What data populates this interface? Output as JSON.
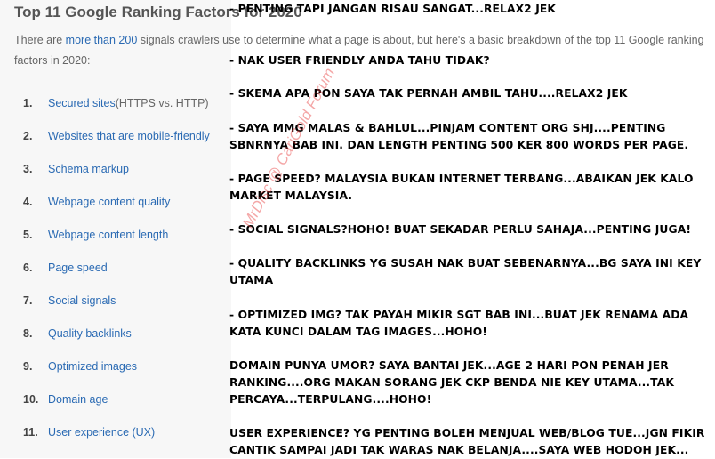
{
  "title": "Top 11 Google Ranking Factors for 2020",
  "intro": {
    "pre": "There are ",
    "link": "more than 200",
    "post": " signals crawlers use to determine what a page is about, but here's a basic breakdown of the top 11 Google ranking",
    "line2": "factors in 2020:"
  },
  "factors": [
    {
      "num": "1.",
      "label": "Secured sites",
      "suffix": " (HTTPS vs. HTTP)"
    },
    {
      "num": "2.",
      "label": "Websites that are mobile-friendly",
      "suffix": ""
    },
    {
      "num": "3.",
      "label": "Schema markup",
      "suffix": ""
    },
    {
      "num": "4.",
      "label": "Webpage content quality",
      "suffix": ""
    },
    {
      "num": "5.",
      "label": "Webpage content length",
      "suffix": ""
    },
    {
      "num": "6.",
      "label": "Page speed",
      "suffix": ""
    },
    {
      "num": "7.",
      "label": "Social signals",
      "suffix": ""
    },
    {
      "num": "8.",
      "label": "Quality backlinks",
      "suffix": ""
    },
    {
      "num": "9.",
      "label": "Optimized images",
      "suffix": ""
    },
    {
      "num": "10.",
      "label": "Domain age",
      "suffix": ""
    },
    {
      "num": "11.",
      "label": "User experience (UX)",
      "suffix": ""
    }
  ],
  "comments": [
    "-  PENTING TAPI JANGAN RISAU SANGAT...RELAX2 JEK",
    "-  NAK USER FRIENDLY ANDA TAHU TIDAK?",
    "- SKEMA APA PON SAYA TAK PERNAH AMBIL TAHU....RELAX2 JEK",
    "- SAYA MMG MALAS & BAHLUL...PINJAM CONTENT ORG SHJ....PENTING",
    "SBNRNYA BAB INI. DAN LENGTH PENTING 500 KER 800 WORDS PER PAGE.",
    "- PAGE SPEED? MALAYSIA BUKAN INTERNET TERBANG...ABAIKAN JEK KALO",
    "MARKET MALAYSIA.",
    "- SOCIAL SIGNALS?HOHO! BUAT SEKADAR PERLU SAHAJA...PENTING JUGA!",
    "- QUALITY BACKLINKS YG SUSAH NAK BUAT SEBENARNYA...BG SAYA INI KEY",
    "UTAMA",
    "- OPTIMIZED IMG? TAK PAYAH MIKIR SGT BAB INI...BUAT JEK RENAMA ADA",
    "KATA KUNCI DALAM TAG IMAGES...HOHO!",
    "DOMAIN PUNYA UMOR? SAYA BANTAI JEK...AGE 2 HARI PON PENAH JER",
    "RANKING....ORG MAKAN SORANG JEK CKP BENDA NIE KEY UTAMA...TAK",
    "PERCAYA...TERPULANG....HOHO!",
    "USER EXPERIENCE? YG PENTING BOLEH MENJUAL WEB/BLOG TUE...JGN FIKIR",
    "CANTIK SAMPAI JADI TAK WARAS NAK BELANJA....SAYA WEB HODOH JEK..."
  ],
  "watermark": "MrDisc @ CariGold Forum",
  "colors": {
    "link": "#2a6ab3",
    "watermark": "#e63c3c"
  }
}
